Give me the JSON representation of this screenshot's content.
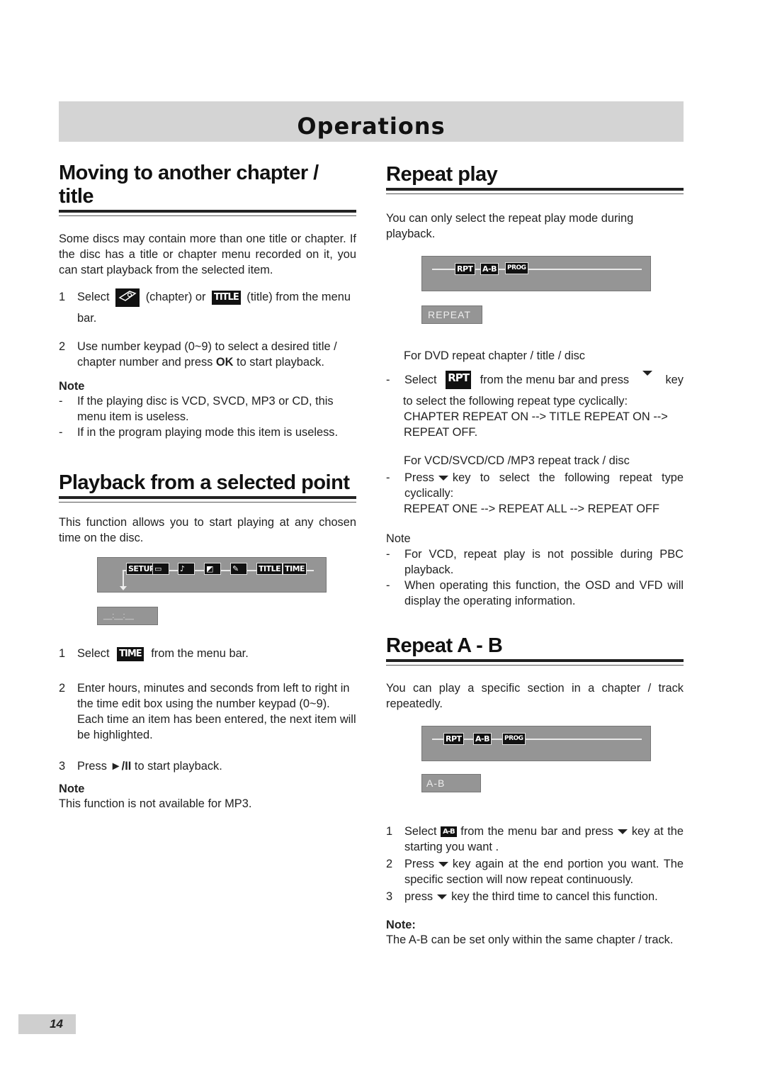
{
  "banner": {
    "title": "Operations"
  },
  "left": {
    "moving": {
      "title": "Moving to another chapter / title",
      "intro": "Some discs may contain more than one title or chapter. If the disc has a title or chapter menu recorded on it, you can start playback from the selected item.",
      "step1": {
        "num": "1",
        "a": "Select",
        "icon1": "chapter-icon",
        "b": "(chapter) or",
        "icon2_label": "TITLE",
        "c": "(title)  from the menu bar."
      },
      "step2": {
        "num": "2",
        "a": "Use number keypad (0~9) to select a desired title / chapter number and press ",
        "bold": "OK",
        "b": " to start playback."
      },
      "note_heading": "Note",
      "notes": [
        {
          "dash": "-",
          "text": "If the playing disc is VCD, SVCD, MP3 or CD, this menu item is useless."
        },
        {
          "dash": "-",
          "text": "If in the program playing mode this item is useless."
        }
      ]
    },
    "playback": {
      "title": "Playback from a selected point",
      "intro": "This function allows you to start playing at any chosen time on the disc.",
      "osd_items": [
        "SETUP",
        "subtitle-icon",
        "audio-icon",
        "angle-icon",
        "chapter-icon",
        "TITLE",
        "TIME"
      ],
      "time_box": "__:__:__",
      "step1": {
        "num": "1",
        "a": "Select",
        "icon_label": "TIME",
        "b": "from the menu bar."
      },
      "step2": {
        "num": "2",
        "text": "Enter hours, minutes and seconds from left to right in the time edit box using the number keypad (0~9). Each time an item has been entered, the next item will be highlighted."
      },
      "step3": {
        "num": "3",
        "a": "Press ",
        "bold": "►/II",
        "b": " to start playback."
      },
      "note_heading": "Note",
      "note_text": "This function is not available for MP3."
    }
  },
  "right": {
    "repeat": {
      "title": "Repeat play",
      "intro": "You can only select the repeat play mode  during playback.",
      "osd_items": [
        "RPT",
        "A-B",
        "PROG"
      ],
      "osd_label": "REPEAT",
      "dvd_heading": "For DVD repeat chapter / title / disc",
      "dvd_step": {
        "dash": "-",
        "a": "Select",
        "icon_label": "RPT",
        "b": "from the menu bar and press",
        "c": "key"
      },
      "dvd_cont": "to select the following repeat type cyclically:",
      "dvd_cycle": "CHAPTER REPEAT ON --> TITLE REPEAT ON --> REPEAT OFF.",
      "vcd_heading": "For VCD/SVCD/CD /MP3 repeat track / disc",
      "vcd_step": {
        "dash": "-",
        "a": "Press",
        "b": "key to select the following repeat type cyclically:"
      },
      "vcd_cycle": "REPEAT ONE -->  REPEAT ALL --> REPEAT OFF",
      "note_heading": "Note",
      "notes": [
        {
          "dash": "-",
          "text": "For VCD, repeat play is not possible during PBC playback."
        },
        {
          "dash": "-",
          "text": "When operating this function, the OSD and VFD will display the operating information."
        }
      ]
    },
    "ab": {
      "title": "Repeat A - B",
      "intro": "You can play a specific section in a chapter / track repeatedly.",
      "osd_items": [
        "RPT",
        "A-B",
        "PROG"
      ],
      "osd_label": "A-B",
      "steps": [
        {
          "num": "1",
          "a": "Select",
          "icon_label": "A-B",
          "b": "from the menu bar and press",
          "c": "key at the starting you want ."
        },
        {
          "num": "2",
          "a": "Press",
          "b": "key again at the end portion you want. The specific section will now repeat continuously."
        },
        {
          "num": "3",
          "a": "press",
          "b": "key the third time to cancel this function."
        }
      ],
      "note_heading": "Note:",
      "note_text": "The A-B can be set only within the same chapter / track."
    }
  },
  "footer": {
    "page_number": "14"
  }
}
